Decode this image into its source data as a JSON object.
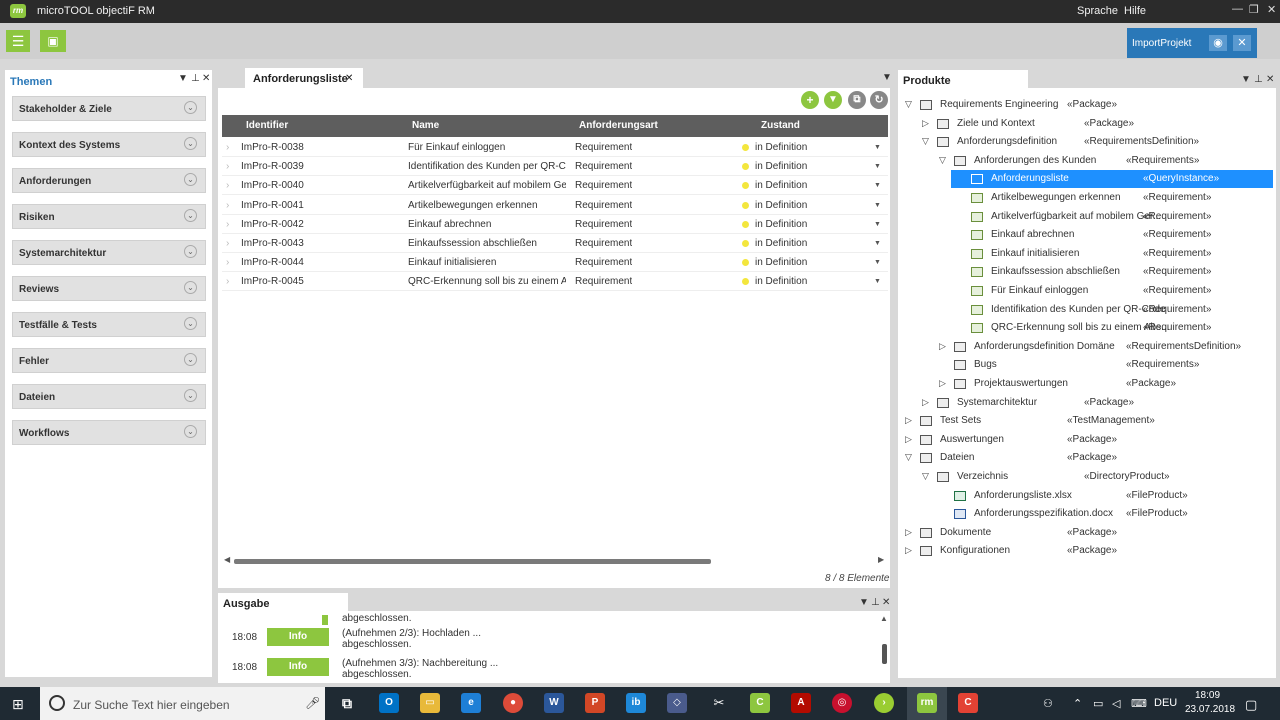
{
  "window": {
    "title": "microTOOL objectiF RM",
    "menu": [
      "Sprache",
      "Hilfe"
    ]
  },
  "toolbar": {
    "import_label": "ImportProjekt"
  },
  "left": {
    "tab": "Themen",
    "items": [
      "Stakeholder & Ziele",
      "Kontext des Systems",
      "Anforderungen",
      "Risiken",
      "Systemarchitektur",
      "Reviews",
      "Testfälle & Tests",
      "Fehler",
      "Dateien",
      "Workflows"
    ]
  },
  "center": {
    "tab": "Anforderungsliste",
    "columns": [
      "Identifier",
      "Name",
      "Anforderungsart",
      "Zustand"
    ],
    "rows": [
      {
        "id": "ImPro-R-0038",
        "name": "Für Einkauf einloggen",
        "type": "Requirement",
        "state": "in Definition"
      },
      {
        "id": "ImPro-R-0039",
        "name": "Identifikation des Kunden per QR-Co",
        "type": "Requirement",
        "state": "in Definition"
      },
      {
        "id": "ImPro-R-0040",
        "name": "Artikelverfügbarkeit auf mobilem Ge",
        "type": "Requirement",
        "state": "in Definition"
      },
      {
        "id": "ImPro-R-0041",
        "name": "Artikelbewegungen erkennen",
        "type": "Requirement",
        "state": "in Definition"
      },
      {
        "id": "ImPro-R-0042",
        "name": "Einkauf abrechnen",
        "type": "Requirement",
        "state": "in Definition"
      },
      {
        "id": "ImPro-R-0043",
        "name": "Einkaufssession abschließen",
        "type": "Requirement",
        "state": "in Definition"
      },
      {
        "id": "ImPro-R-0044",
        "name": "Einkauf initialisieren",
        "type": "Requirement",
        "state": "in Definition"
      },
      {
        "id": "ImPro-R-0045",
        "name": "QRC-Erkennung soll bis zu einem Ab",
        "type": "Requirement",
        "state": "in Definition"
      }
    ],
    "count": "8 / 8 Elemente"
  },
  "output": {
    "tab": "Ausgabe",
    "top_fragment": "abgeschlossen.",
    "entries": [
      {
        "time": "18:08",
        "level": "Info",
        "line1": "(Aufnehmen 2/3): Hochladen ...",
        "line2": "abgeschlossen."
      },
      {
        "time": "18:08",
        "level": "Info",
        "line1": "(Aufnehmen 3/3): Nachbereitung ...",
        "line2": "abgeschlossen."
      }
    ]
  },
  "right": {
    "tab": "Produkte",
    "tree": [
      {
        "label": "Requirements Engineering",
        "stereo": "«Package»",
        "exp": "▽"
      },
      {
        "label": "Ziele und Kontext",
        "stereo": "«Package»",
        "exp": "▷"
      },
      {
        "label": "Anforderungsdefinition",
        "stereo": "«RequirementsDefinition»",
        "exp": "▽"
      },
      {
        "label": "Anforderungen des Kunden",
        "stereo": "«Requirements»",
        "exp": "▽"
      },
      {
        "label": "Anforderungsliste",
        "stereo": "«QueryInstance»",
        "exp": ""
      },
      {
        "label": "Artikelbewegungen erkennen",
        "stereo": "«Requirement»",
        "exp": ""
      },
      {
        "label": "Artikelverfügbarkeit auf mobilem Ger...",
        "stereo": "«Requirement»",
        "exp": ""
      },
      {
        "label": "Einkauf abrechnen",
        "stereo": "«Requirement»",
        "exp": ""
      },
      {
        "label": "Einkauf initialisieren",
        "stereo": "«Requirement»",
        "exp": ""
      },
      {
        "label": "Einkaufssession abschließen",
        "stereo": "«Requirement»",
        "exp": ""
      },
      {
        "label": "Für Einkauf einloggen",
        "stereo": "«Requirement»",
        "exp": ""
      },
      {
        "label": "Identifikation des Kunden per QR-Code",
        "stereo": "«Requirement»",
        "exp": ""
      },
      {
        "label": "QRC-Erkennung soll bis zu einem Abs...",
        "stereo": "«Requirement»",
        "exp": ""
      },
      {
        "label": "Anforderungsdefinition Domäne",
        "stereo": "«RequirementsDefinition»",
        "exp": "▷"
      },
      {
        "label": "Bugs",
        "stereo": "«Requirements»",
        "exp": ""
      },
      {
        "label": "Projektauswertungen",
        "stereo": "«Package»",
        "exp": "▷"
      },
      {
        "label": "Systemarchitektur",
        "stereo": "«Package»",
        "exp": "▷"
      },
      {
        "label": "Test Sets",
        "stereo": "«TestManagement»",
        "exp": "▷"
      },
      {
        "label": "Auswertungen",
        "stereo": "«Package»",
        "exp": "▷"
      },
      {
        "label": "Dateien",
        "stereo": "«Package»",
        "exp": "▽"
      },
      {
        "label": "Verzeichnis",
        "stereo": "«DirectoryProduct»",
        "exp": "▽"
      },
      {
        "label": "Anforderungsliste.xlsx",
        "stereo": "«FileProduct»",
        "exp": ""
      },
      {
        "label": "Anforderungsspezifikation.docx",
        "stereo": "«FileProduct»",
        "exp": ""
      },
      {
        "label": "Dokumente",
        "stereo": "«Package»",
        "exp": "▷"
      },
      {
        "label": "Konfigurationen",
        "stereo": "«Package»",
        "exp": "▷"
      }
    ]
  },
  "taskbar": {
    "search_placeholder": "Zur Suche Text hier eingeben",
    "lang": "DEU",
    "time": "18:09",
    "date": "23.07.2018"
  }
}
